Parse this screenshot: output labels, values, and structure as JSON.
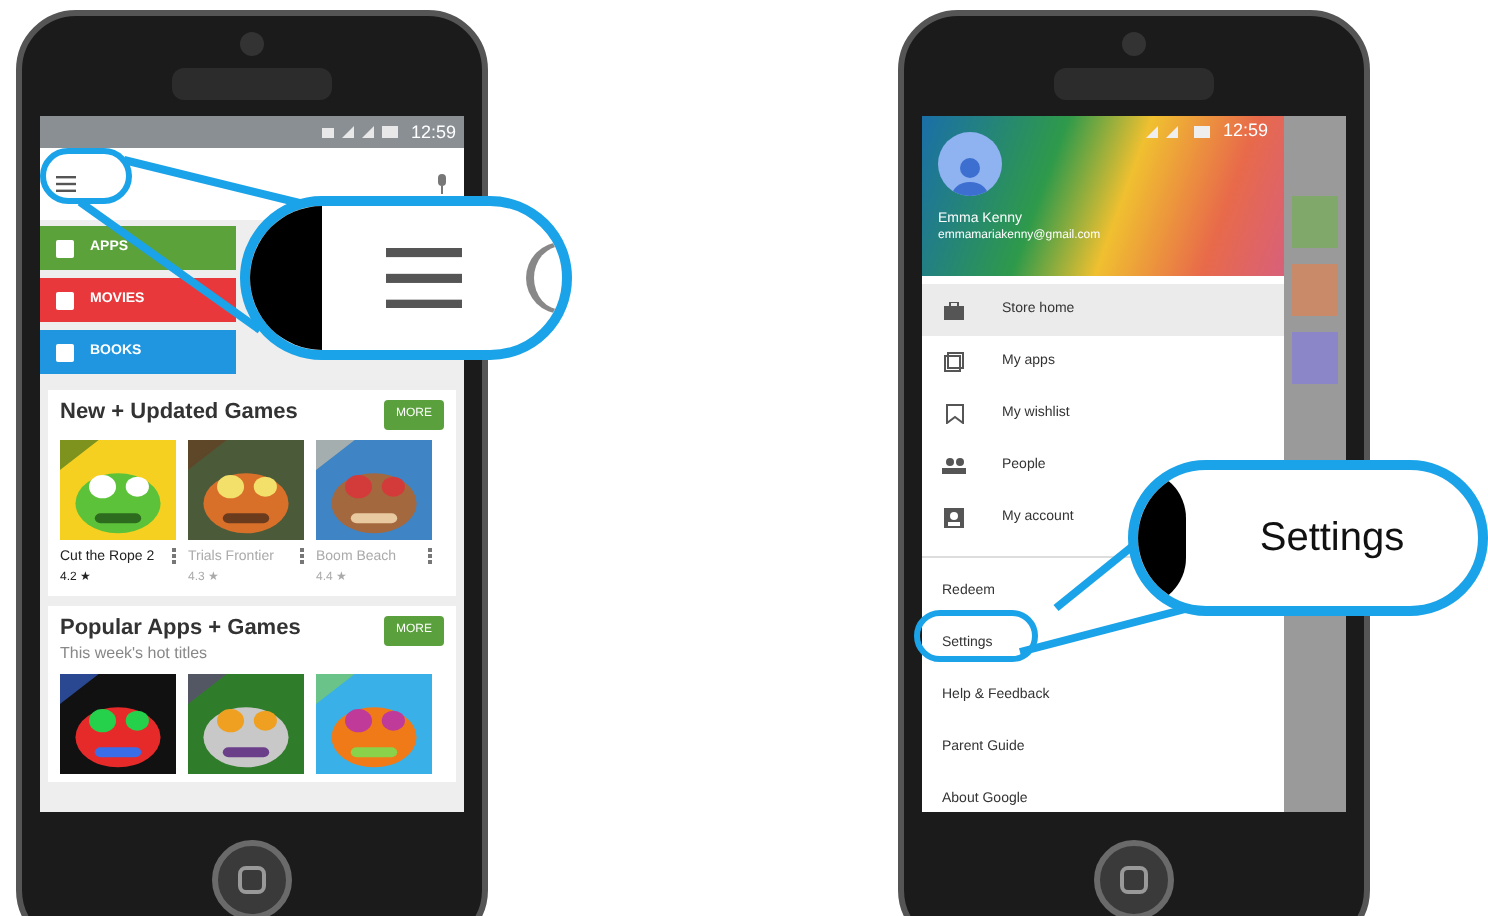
{
  "left_phone": {
    "status_time": "12:59",
    "categories": [
      {
        "label": "APPS",
        "color": "#5ca23a"
      },
      {
        "label": "MOVIES",
        "color": "#e8383b"
      },
      {
        "label": "BOOKS",
        "color": "#2196e0"
      }
    ],
    "sections": [
      {
        "title": "New + Updated Games",
        "button": "MORE",
        "apps": [
          {
            "name": "Cut the Rope 2",
            "rating": "4.2 ★",
            "faded": false
          },
          {
            "name": "Trials Frontier",
            "rating": "4.3 ★",
            "faded": true
          },
          {
            "name": "Boom Beach",
            "rating": "4.4 ★",
            "faded": true
          }
        ]
      },
      {
        "title": "Popular Apps + Games",
        "subtitle": "This week's hot titles",
        "button": "MORE"
      }
    ]
  },
  "right_phone": {
    "status_time": "12:59",
    "account": {
      "name": "Emma Kenny",
      "email": "emmamariakenny@gmail.com"
    },
    "menu": [
      {
        "label": "Store home",
        "kind": "store",
        "selected": true
      },
      {
        "label": "My apps",
        "kind": "apps",
        "selected": false
      },
      {
        "label": "My wishlist",
        "kind": "wishlist",
        "selected": false
      },
      {
        "label": "People",
        "kind": "people",
        "selected": false
      },
      {
        "label": "My account",
        "kind": "account",
        "selected": false
      }
    ],
    "links": [
      "Redeem",
      "Settings",
      "Help & Feedback",
      "Parent Guide",
      "About Google"
    ],
    "callout": "Settings"
  }
}
